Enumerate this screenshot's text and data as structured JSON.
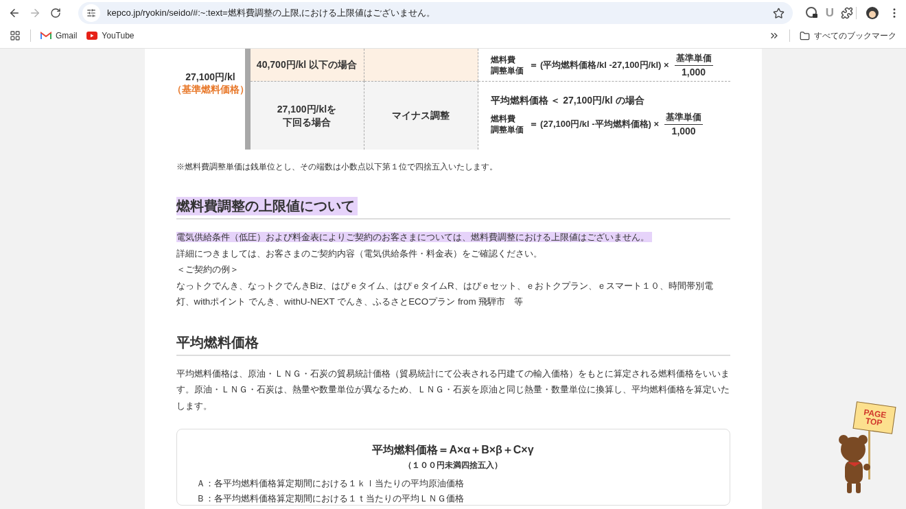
{
  "browser": {
    "url": "kepco.jp/ryokin/seido/#:~:text=燃料費調整の上限,における上限値はございません。",
    "extension_letter": "U",
    "bookmarks": [
      {
        "kind": "gmail",
        "label": "Gmail"
      },
      {
        "kind": "youtube",
        "label": "YouTube"
      }
    ],
    "all_bookmarks": "すべてのブックマーク"
  },
  "fuel_table": {
    "base_price": "27,100円/kl",
    "base_note": "（基準燃料価格）",
    "rows": [
      {
        "kind": "upper",
        "condition": [
          "40,700円/kl 以下の場合"
        ],
        "formula": {
          "label": [
            "燃料費",
            "調整単価"
          ],
          "expression": "＝ (平均燃料価格/kl -27,100円/kl) ×",
          "numerator": "基準単価",
          "denominator": "1,000"
        }
      },
      {
        "kind": "lower",
        "condition": [
          "27,100円/klを",
          "下回る場合"
        ],
        "adjustment": "マイナス調整",
        "formula": {
          "condition": "平均燃料価格 ＜ 27,100円/kl の場合",
          "label": [
            "燃料費",
            "調整単価"
          ],
          "expression": "＝ (27,100円/kl -平均燃料価格) ×",
          "numerator": "基準単価",
          "denominator": "1,000"
        }
      }
    ]
  },
  "note": "※燃料費調整単価は銭単位とし、その端数は小数点以下第１位で四捨五入いたします。",
  "sections": [
    {
      "heading": "燃料費調整の上限値について",
      "highlighted": true,
      "paragraphs": [
        {
          "text": "電気供給条件（低圧）および料金表によりご契約のお客さまについては、燃料費調整における上限値はございません。",
          "highlighted": true
        },
        {
          "text": "詳細につきましては、お客さまのご契約内容（電気供給条件・料金表）をご確認ください。",
          "highlighted": false
        },
        {
          "text": "＜ご契約の例＞",
          "highlighted": false
        },
        {
          "text": "なっトクでんき、なっトクでんきBiz、はぴｅタイム、はぴｅタイムR、はぴｅセット、ｅおトクプラン、ｅスマート１０、時間帯別電灯、withポイント でんき、withU-NEXT でんき、ふるさとECOプラン from 飛騨市　等",
          "highlighted": false
        }
      ]
    },
    {
      "heading": "平均燃料価格",
      "highlighted": false,
      "paragraphs": [
        {
          "text": "平均燃料価格は、原油・ＬＮＧ・石炭の貿易統計価格（貿易統計にて公表される円建ての輸入価格）をもとに算定される燃料価格をいいます。原油・ＬＮＧ・石炭は、熱量や数量単位が異なるため、ＬＮＧ・石炭を原油と同じ熱量・数量単位に換算し、平均燃料価格を算定いたします。",
          "highlighted": false
        }
      ],
      "formula_box": {
        "title": "平均燃料価格＝A×α＋B×β＋C×γ",
        "subtitle": "（１００円未満四捨五入）",
        "items": [
          "Ａ：各平均燃料価格算定期間における１ｋｌ当たりの平均原油価格",
          "Ｂ：各平均燃料価格算定期間における１ｔ当たりの平均ＬＮＧ価格"
        ]
      }
    }
  ],
  "page_top": {
    "lines": [
      "PAGE",
      "TOP"
    ]
  }
}
